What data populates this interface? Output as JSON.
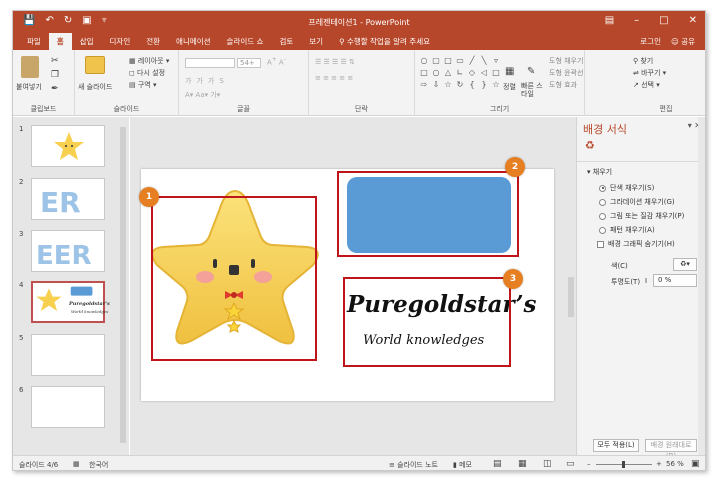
{
  "window": {
    "title": "프레젠테이션1 - PowerPoint",
    "quick_access": [
      "save-icon",
      "undo-icon",
      "redo-icon",
      "start-slideshow-icon",
      "customize-qat-icon"
    ],
    "controls": [
      "ribbon-display-icon",
      "minimize-icon",
      "maximize-icon",
      "close-icon"
    ]
  },
  "tabs": {
    "items": [
      "파일",
      "홈",
      "삽입",
      "디자인",
      "전환",
      "애니메이션",
      "슬라이드 쇼",
      "검토",
      "보기"
    ],
    "active": "홈",
    "tell_me": "수행할 작업을 알려 주세요",
    "login": "로그인",
    "share": "공유"
  },
  "ribbon": {
    "groups": {
      "clipboard": "클립보드",
      "slides": "슬라이드",
      "font": "글꼴",
      "paragraph": "단락",
      "drawing": "그리기",
      "editing": "편집"
    },
    "paste": "붙여넣기",
    "new_slide": "새 슬라이드",
    "layout": "레이아웃",
    "reset": "다시 설정",
    "section": "구역",
    "font_size": "54+",
    "arrange": "정렬",
    "quick_styles": "빠른 스타일",
    "shape_fill": "도형 채우기",
    "shape_outline": "도형 윤곽선",
    "shape_effects": "도형 효과",
    "find": "찾기",
    "replace": "바꾸기",
    "select": "선택"
  },
  "thumbnails": {
    "numbers": [
      "1",
      "2",
      "3",
      "4",
      "5",
      "6"
    ],
    "selected": "4",
    "slide4_brand": "Puregoldstar's",
    "slide4_sub": "World knowledges"
  },
  "slide": {
    "badges": [
      "1",
      "2",
      "3"
    ],
    "brand": "Puregoldstar’s",
    "subtitle": "World knowledges",
    "colors": {
      "highlight": "#c0141b",
      "badge": "#e67e22",
      "blue_shape": "#5b9bd5",
      "star": "#f7d04f"
    }
  },
  "pane": {
    "title": "배경 서식",
    "section": "채우기",
    "options": [
      {
        "label": "단색 채우기(S)",
        "selected": true
      },
      {
        "label": "그라데이션 채우기(G)",
        "selected": false
      },
      {
        "label": "그림 또는 질감 채우기(P)",
        "selected": false
      },
      {
        "label": "패턴 채우기(A)",
        "selected": false
      }
    ],
    "hide_graphics": "배경 그래픽 숨기기(H)",
    "color_label": "색(C)",
    "transparency_label": "투명도(T)",
    "transparency_value": "0 %",
    "apply_all": "모두 적용(L)",
    "reset_background": "배경 원래대로(B)"
  },
  "status": {
    "slide_info": "슬라이드 4/6",
    "language": "한국어",
    "notes": "슬라이드 노트",
    "comments": "메모",
    "zoom": "56 %"
  }
}
